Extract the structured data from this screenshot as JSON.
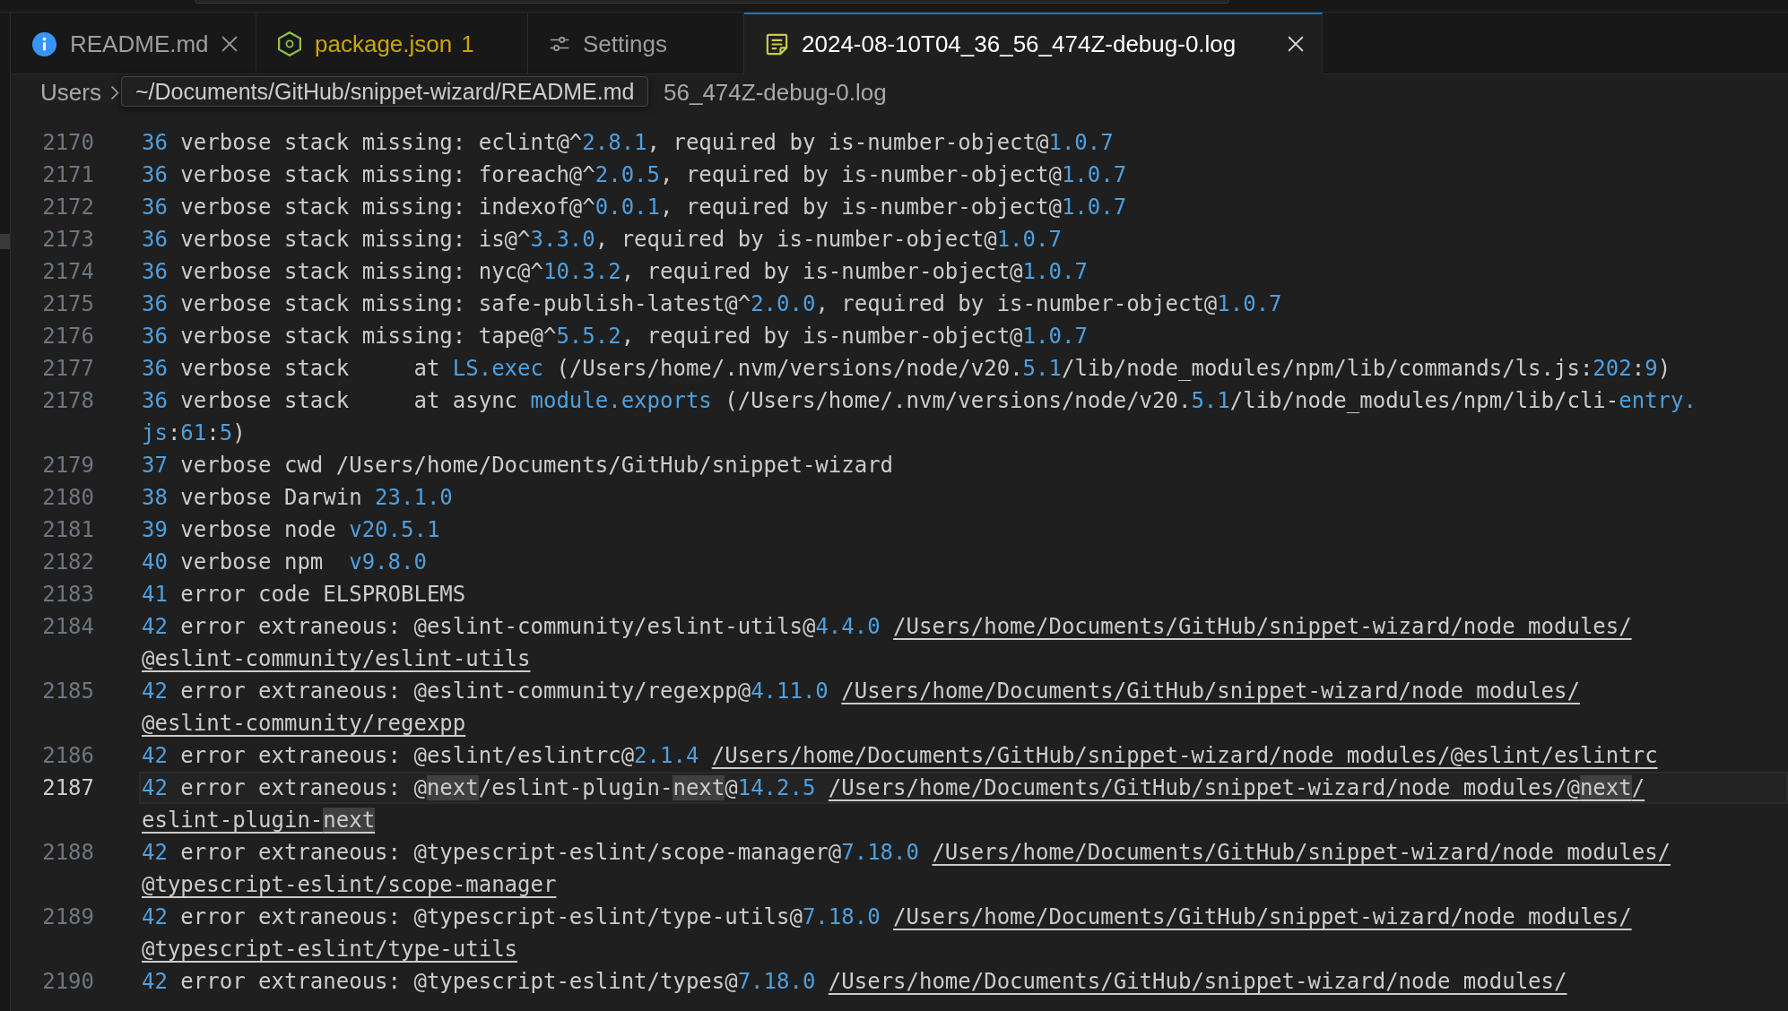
{
  "tabs": [
    {
      "label": "README.md",
      "kind": "markdown",
      "selected": false,
      "warning": false,
      "close": true
    },
    {
      "label": "package.json",
      "kind": "json",
      "selected": false,
      "warning": true,
      "problems": "1",
      "close": false
    },
    {
      "label": "Settings",
      "kind": "settings",
      "selected": false,
      "warning": false,
      "close": false
    },
    {
      "label": "2024-08-10T04_36_56_474Z-debug-0.log",
      "kind": "log",
      "selected": true,
      "warning": false,
      "close": true
    }
  ],
  "breadcrumb": {
    "items": [
      "Users",
      "56_474Z-debug-0.log"
    ]
  },
  "tooltip": {
    "text": "~/Documents/GitHub/snippet-wizard/README.md"
  },
  "editor": {
    "lines": [
      {
        "number": "2170",
        "active": false,
        "text": [
          {
            "kind": "const",
            "text": "36"
          },
          {
            "kind": "plain",
            "text": " verbose stack missing: eclint@^"
          },
          {
            "kind": "const",
            "text": "2.8.1"
          },
          {
            "kind": "plain",
            "text": ", required by is-number-object@"
          },
          {
            "kind": "const",
            "text": "1.0.7"
          }
        ]
      },
      {
        "number": "2171",
        "active": false,
        "text": [
          {
            "kind": "const",
            "text": "36"
          },
          {
            "kind": "plain",
            "text": " verbose stack missing: foreach@^"
          },
          {
            "kind": "const",
            "text": "2.0.5"
          },
          {
            "kind": "plain",
            "text": ", required by is-number-object@"
          },
          {
            "kind": "const",
            "text": "1.0.7"
          }
        ]
      },
      {
        "number": "2172",
        "active": false,
        "text": [
          {
            "kind": "const",
            "text": "36"
          },
          {
            "kind": "plain",
            "text": " verbose stack missing: indexof@^"
          },
          {
            "kind": "const",
            "text": "0.0.1"
          },
          {
            "kind": "plain",
            "text": ", required by is-number-object@"
          },
          {
            "kind": "const",
            "text": "1.0.7"
          }
        ]
      },
      {
        "number": "2173",
        "active": false,
        "text": [
          {
            "kind": "const",
            "text": "36"
          },
          {
            "kind": "plain",
            "text": " verbose stack missing: is@^"
          },
          {
            "kind": "const",
            "text": "3.3.0"
          },
          {
            "kind": "plain",
            "text": ", required by is-number-object@"
          },
          {
            "kind": "const",
            "text": "1.0.7"
          }
        ]
      },
      {
        "number": "2174",
        "active": false,
        "text": [
          {
            "kind": "const",
            "text": "36"
          },
          {
            "kind": "plain",
            "text": " verbose stack missing: nyc@^"
          },
          {
            "kind": "const",
            "text": "10.3.2"
          },
          {
            "kind": "plain",
            "text": ", required by is-number-object@"
          },
          {
            "kind": "const",
            "text": "1.0.7"
          }
        ]
      },
      {
        "number": "2175",
        "active": false,
        "text": [
          {
            "kind": "const",
            "text": "36"
          },
          {
            "kind": "plain",
            "text": " verbose stack missing: safe-publish-latest@^"
          },
          {
            "kind": "const",
            "text": "2.0.0"
          },
          {
            "kind": "plain",
            "text": ", required by is-number-object@"
          },
          {
            "kind": "const",
            "text": "1.0.7"
          }
        ]
      },
      {
        "number": "2176",
        "active": false,
        "text": [
          {
            "kind": "const",
            "text": "36"
          },
          {
            "kind": "plain",
            "text": " verbose stack missing: tape@^"
          },
          {
            "kind": "const",
            "text": "5.5.2"
          },
          {
            "kind": "plain",
            "text": ", required by is-number-object@"
          },
          {
            "kind": "const",
            "text": "1.0.7"
          }
        ]
      },
      {
        "number": "2177",
        "active": false,
        "text": [
          {
            "kind": "const",
            "text": "36"
          },
          {
            "kind": "plain",
            "text": " verbose stack     at "
          },
          {
            "kind": "const",
            "text": "LS.exec"
          },
          {
            "kind": "plain",
            "text": " (/Users/home/.nvm/versions/node/v20."
          },
          {
            "kind": "const",
            "text": "5.1"
          },
          {
            "kind": "plain",
            "text": "/lib/node_modules/npm/lib/commands/ls.js:"
          },
          {
            "kind": "const",
            "text": "202"
          },
          {
            "kind": "plain",
            "text": ":"
          },
          {
            "kind": "const",
            "text": "9"
          },
          {
            "kind": "plain",
            "text": ")"
          }
        ]
      },
      {
        "number": "2178",
        "active": false,
        "text": [
          {
            "kind": "const",
            "text": "36"
          },
          {
            "kind": "plain",
            "text": " verbose stack     at async "
          },
          {
            "kind": "const",
            "text": "module.exports"
          },
          {
            "kind": "plain",
            "text": " (/Users/home/.nvm/versions/node/v20."
          },
          {
            "kind": "const",
            "text": "5.1"
          },
          {
            "kind": "plain",
            "text": "/lib/node_modules/npm/lib/cli-"
          },
          {
            "kind": "const",
            "text": "entry."
          }
        ],
        "wrap": [
          {
            "kind": "const",
            "text": "js"
          },
          {
            "kind": "plain",
            "text": ":"
          },
          {
            "kind": "const",
            "text": "61"
          },
          {
            "kind": "plain",
            "text": ":"
          },
          {
            "kind": "const",
            "text": "5"
          },
          {
            "kind": "plain",
            "text": ")"
          }
        ]
      },
      {
        "number": "2179",
        "active": false,
        "text": [
          {
            "kind": "const",
            "text": "37"
          },
          {
            "kind": "plain",
            "text": " verbose cwd /Users/home/Documents/GitHub/snippet-wizard"
          }
        ]
      },
      {
        "number": "2180",
        "active": false,
        "text": [
          {
            "kind": "const",
            "text": "38"
          },
          {
            "kind": "plain",
            "text": " verbose Darwin "
          },
          {
            "kind": "const",
            "text": "23.1.0"
          }
        ]
      },
      {
        "number": "2181",
        "active": false,
        "text": [
          {
            "kind": "const",
            "text": "39"
          },
          {
            "kind": "plain",
            "text": " verbose node "
          },
          {
            "kind": "const",
            "text": "v20.5.1"
          }
        ]
      },
      {
        "number": "2182",
        "active": false,
        "text": [
          {
            "kind": "const",
            "text": "40"
          },
          {
            "kind": "plain",
            "text": " verbose npm  "
          },
          {
            "kind": "const",
            "text": "v9.8.0"
          }
        ]
      },
      {
        "number": "2183",
        "active": false,
        "text": [
          {
            "kind": "const",
            "text": "41"
          },
          {
            "kind": "plain",
            "text": " error code ELSPROBLEMS"
          }
        ]
      },
      {
        "number": "2184",
        "active": false,
        "text": [
          {
            "kind": "const",
            "text": "42"
          },
          {
            "kind": "plain",
            "text": " error extraneous: @eslint-community/eslint-utils@"
          },
          {
            "kind": "const",
            "text": "4.4.0 "
          },
          {
            "kind": "link",
            "text": "/Users/home/Documents/GitHub/snippet-wizard/node_modules/"
          }
        ],
        "wrap": [
          {
            "kind": "link",
            "text": "@eslint-community/eslint-utils"
          }
        ]
      },
      {
        "number": "2185",
        "active": false,
        "text": [
          {
            "kind": "const",
            "text": "42"
          },
          {
            "kind": "plain",
            "text": " error extraneous: @eslint-community/regexpp@"
          },
          {
            "kind": "const",
            "text": "4.11.0 "
          },
          {
            "kind": "link",
            "text": "/Users/home/Documents/GitHub/snippet-wizard/node_modules/"
          }
        ],
        "wrap": [
          {
            "kind": "link",
            "text": "@eslint-community/regexpp"
          }
        ]
      },
      {
        "number": "2186",
        "active": false,
        "text": [
          {
            "kind": "const",
            "text": "42"
          },
          {
            "kind": "plain",
            "text": " error extraneous: @eslint/eslintrc@"
          },
          {
            "kind": "const",
            "text": "2.1.4 "
          },
          {
            "kind": "link",
            "text": "/Users/home/Documents/GitHub/snippet-wizard/node_modules/@eslint/eslintrc"
          }
        ]
      },
      {
        "number": "2187",
        "active": true,
        "text": [
          {
            "kind": "const",
            "text": "42"
          },
          {
            "kind": "plain",
            "text": " error extraneous: @"
          },
          {
            "kind": "match",
            "text": "next"
          },
          {
            "kind": "plain",
            "text": "/eslint-plugin-"
          },
          {
            "kind": "match",
            "text": "next"
          },
          {
            "kind": "plain",
            "text": "@"
          },
          {
            "kind": "const",
            "text": "14.2.5 "
          },
          {
            "kind": "link",
            "parts": [
              {
                "kind": "plain",
                "text": "/Users/home/Documents/GitHub/snippet-wizard/node_modules/@"
              },
              {
                "kind": "match",
                "text": "next"
              },
              {
                "kind": "plain",
                "text": "/"
              }
            ]
          }
        ],
        "wrap": [
          {
            "kind": "link",
            "parts": [
              {
                "kind": "plain",
                "text": "eslint-plugin-"
              },
              {
                "kind": "match",
                "text": "next"
              }
            ]
          }
        ]
      },
      {
        "number": "2188",
        "active": false,
        "text": [
          {
            "kind": "const",
            "text": "42"
          },
          {
            "kind": "plain",
            "text": " error extraneous: @typescript-eslint/scope-manager@"
          },
          {
            "kind": "const",
            "text": "7.18.0 "
          },
          {
            "kind": "link",
            "text": "/Users/home/Documents/GitHub/snippet-wizard/node_modules/"
          }
        ],
        "wrap": [
          {
            "kind": "link",
            "text": "@typescript-eslint/scope-manager"
          }
        ]
      },
      {
        "number": "2189",
        "active": false,
        "text": [
          {
            "kind": "const",
            "text": "42"
          },
          {
            "kind": "plain",
            "text": " error extraneous: @typescript-eslint/type-utils@"
          },
          {
            "kind": "const",
            "text": "7.18.0 "
          },
          {
            "kind": "link",
            "text": "/Users/home/Documents/GitHub/snippet-wizard/node_modules/"
          }
        ],
        "wrap": [
          {
            "kind": "link",
            "text": "@typescript-eslint/type-utils"
          }
        ]
      },
      {
        "number": "2190",
        "active": false,
        "text": [
          {
            "kind": "const",
            "text": "42"
          },
          {
            "kind": "plain",
            "text": " error extraneous: @typescript-eslint/types@"
          },
          {
            "kind": "const",
            "text": "7.18.0 "
          },
          {
            "kind": "link",
            "text": "/Users/home/Documents/GitHub/snippet-wizard/node_modules/"
          }
        ]
      }
    ]
  }
}
